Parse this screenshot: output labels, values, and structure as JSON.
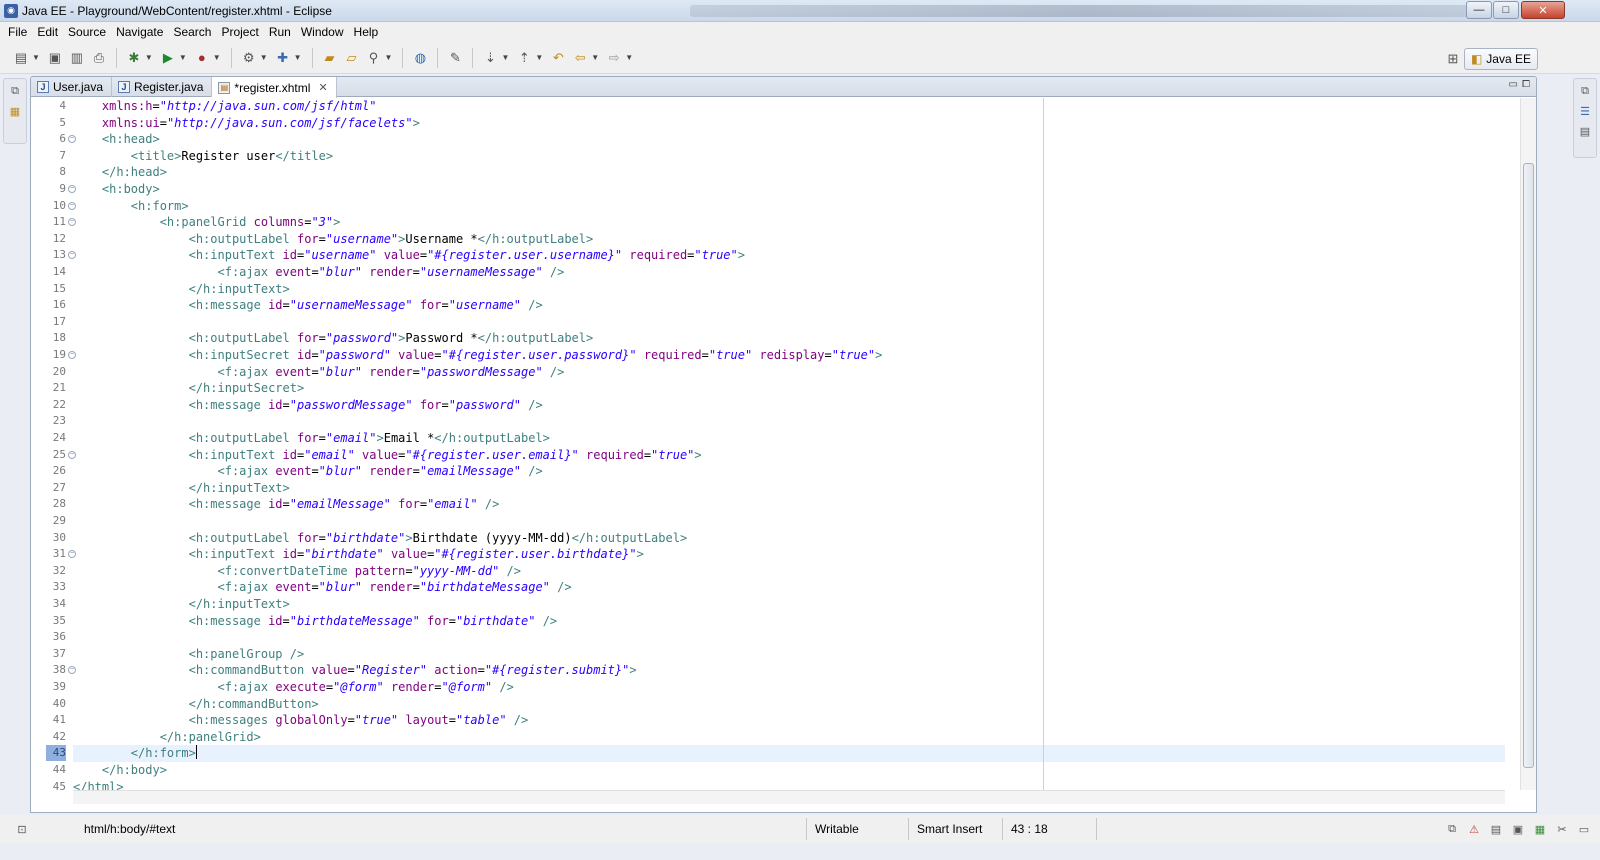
{
  "window": {
    "title": "Java EE - Playground/WebContent/register.xhtml - Eclipse",
    "controls": {
      "minimize": "—",
      "maximize": "□",
      "close": "✕"
    }
  },
  "menubar": [
    "File",
    "Edit",
    "Source",
    "Navigate",
    "Search",
    "Project",
    "Run",
    "Window",
    "Help"
  ],
  "toolbar": {
    "icons": [
      "new-icon",
      "save-icon",
      "save-all-icon",
      "print-icon",
      "debug-icon",
      "run-icon",
      "external-tools-icon",
      "new-server-icon",
      "new-wizard-icon",
      "open-type-icon",
      "open-resource-icon",
      "search-icon",
      "globe-icon",
      "annotation-icon",
      "next-annotation-icon",
      "previous-annotation-icon",
      "last-edit-icon",
      "back-icon",
      "forward-icon"
    ]
  },
  "perspective": {
    "label": "Java EE"
  },
  "tabs": [
    {
      "label": "User.java",
      "type": "java",
      "active": false
    },
    {
      "label": "Register.java",
      "type": "java",
      "active": false
    },
    {
      "label": "*register.xhtml",
      "type": "xhtml",
      "active": true
    }
  ],
  "editor": {
    "current_line": 43,
    "lines": [
      {
        "n": "4",
        "fold": false,
        "text": "    xmlns:h=\"http://java.sun.com/jsf/html\""
      },
      {
        "n": "5",
        "fold": false,
        "text": "    xmlns:ui=\"http://java.sun.com/jsf/facelets\">"
      },
      {
        "n": "6",
        "fold": true,
        "text": "    <h:head>"
      },
      {
        "n": "7",
        "fold": false,
        "text": "        <title>Register user</title>"
      },
      {
        "n": "8",
        "fold": false,
        "text": "    </h:head>"
      },
      {
        "n": "9",
        "fold": true,
        "text": "    <h:body>"
      },
      {
        "n": "10",
        "fold": true,
        "text": "        <h:form>"
      },
      {
        "n": "11",
        "fold": true,
        "text": "            <h:panelGrid columns=\"3\">"
      },
      {
        "n": "12",
        "fold": false,
        "text": "                <h:outputLabel for=\"username\">Username *</h:outputLabel>"
      },
      {
        "n": "13",
        "fold": true,
        "text": "                <h:inputText id=\"username\" value=\"#{register.user.username}\" required=\"true\">"
      },
      {
        "n": "14",
        "fold": false,
        "text": "                    <f:ajax event=\"blur\" render=\"usernameMessage\" />"
      },
      {
        "n": "15",
        "fold": false,
        "text": "                </h:inputText>"
      },
      {
        "n": "16",
        "fold": false,
        "text": "                <h:message id=\"usernameMessage\" for=\"username\" />"
      },
      {
        "n": "17",
        "fold": false,
        "text": ""
      },
      {
        "n": "18",
        "fold": false,
        "text": "                <h:outputLabel for=\"password\">Password *</h:outputLabel>"
      },
      {
        "n": "19",
        "fold": true,
        "text": "                <h:inputSecret id=\"password\" value=\"#{register.user.password}\" required=\"true\" redisplay=\"true\">"
      },
      {
        "n": "20",
        "fold": false,
        "text": "                    <f:ajax event=\"blur\" render=\"passwordMessage\" />"
      },
      {
        "n": "21",
        "fold": false,
        "text": "                </h:inputSecret>"
      },
      {
        "n": "22",
        "fold": false,
        "text": "                <h:message id=\"passwordMessage\" for=\"password\" />"
      },
      {
        "n": "23",
        "fold": false,
        "text": ""
      },
      {
        "n": "24",
        "fold": false,
        "text": "                <h:outputLabel for=\"email\">Email *</h:outputLabel>"
      },
      {
        "n": "25",
        "fold": true,
        "text": "                <h:inputText id=\"email\" value=\"#{register.user.email}\" required=\"true\">"
      },
      {
        "n": "26",
        "fold": false,
        "text": "                    <f:ajax event=\"blur\" render=\"emailMessage\" />"
      },
      {
        "n": "27",
        "fold": false,
        "text": "                </h:inputText>"
      },
      {
        "n": "28",
        "fold": false,
        "text": "                <h:message id=\"emailMessage\" for=\"email\" />"
      },
      {
        "n": "29",
        "fold": false,
        "text": ""
      },
      {
        "n": "30",
        "fold": false,
        "text": "                <h:outputLabel for=\"birthdate\">Birthdate (yyyy-MM-dd)</h:outputLabel>"
      },
      {
        "n": "31",
        "fold": true,
        "text": "                <h:inputText id=\"birthdate\" value=\"#{register.user.birthdate}\">"
      },
      {
        "n": "32",
        "fold": false,
        "text": "                    <f:convertDateTime pattern=\"yyyy-MM-dd\" />"
      },
      {
        "n": "33",
        "fold": false,
        "text": "                    <f:ajax event=\"blur\" render=\"birthdateMessage\" />"
      },
      {
        "n": "34",
        "fold": false,
        "text": "                </h:inputText>"
      },
      {
        "n": "35",
        "fold": false,
        "text": "                <h:message id=\"birthdateMessage\" for=\"birthdate\" />"
      },
      {
        "n": "36",
        "fold": false,
        "text": ""
      },
      {
        "n": "37",
        "fold": false,
        "text": "                <h:panelGroup />"
      },
      {
        "n": "38",
        "fold": true,
        "text": "                <h:commandButton value=\"Register\" action=\"#{register.submit}\">"
      },
      {
        "n": "39",
        "fold": false,
        "text": "                    <f:ajax execute=\"@form\" render=\"@form\" />"
      },
      {
        "n": "40",
        "fold": false,
        "text": "                </h:commandButton>"
      },
      {
        "n": "41",
        "fold": false,
        "text": "                <h:messages globalOnly=\"true\" layout=\"table\" />"
      },
      {
        "n": "42",
        "fold": false,
        "text": "            </h:panelGrid>"
      },
      {
        "n": "43",
        "fold": false,
        "text": "        </h:form>"
      },
      {
        "n": "44",
        "fold": false,
        "text": "    </h:body>"
      },
      {
        "n": "45",
        "fold": false,
        "text": "</html>"
      }
    ]
  },
  "statusbar": {
    "path": "html/h:body/#text",
    "mode": "Writable",
    "insert": "Smart Insert",
    "position": "43 : 18"
  },
  "colors": {
    "tag": "#3f7f7f",
    "attribute": "#7f007f",
    "string": "#2a00ff",
    "current_line": "#e8f2fe"
  }
}
